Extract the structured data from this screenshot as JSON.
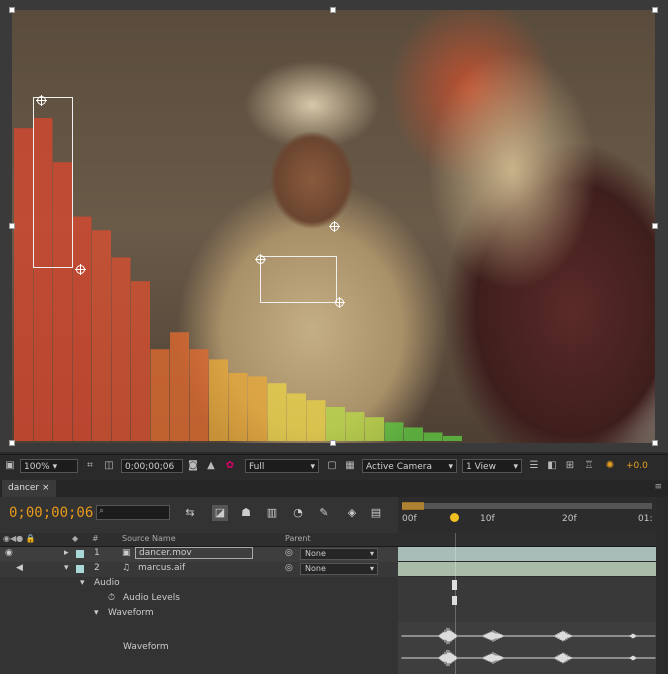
{
  "comp_viewer": {
    "histogram_colors": [
      "#d84830",
      "#d85030",
      "#e06a30",
      "#e8a838",
      "#e8d048",
      "#b8d848",
      "#5ec840"
    ],
    "histogram_values": [
      0.92,
      0.95,
      0.82,
      0.66,
      0.62,
      0.54,
      0.47,
      0.27,
      0.32,
      0.27,
      0.24,
      0.2,
      0.19,
      0.17,
      0.14,
      0.12,
      0.1,
      0.085,
      0.07,
      0.055,
      0.04,
      0.025,
      0.015
    ]
  },
  "viewer_toolbar": {
    "magnification": "100%",
    "timecode": "0;00;00;06",
    "resolution": "Full",
    "camera": "Active Camera",
    "views": "1 View",
    "exposure": "+0.0"
  },
  "comp_tab": {
    "label": "dancer"
  },
  "timeline": {
    "current_time": "0;00;00;06",
    "ruler_labels": [
      "00f",
      "10f",
      "20f",
      "01:"
    ],
    "columns": {
      "source_name": "Source Name",
      "parent": "Parent"
    },
    "layers": [
      {
        "index": "1",
        "name": "dancer.mov",
        "parent": "None"
      },
      {
        "index": "2",
        "name": "marcus.aif",
        "parent": "None"
      }
    ],
    "properties": [
      {
        "label": "Audio"
      },
      {
        "label": "Audio Levels"
      },
      {
        "label": "Waveform"
      },
      {
        "label": "Waveform"
      }
    ]
  }
}
